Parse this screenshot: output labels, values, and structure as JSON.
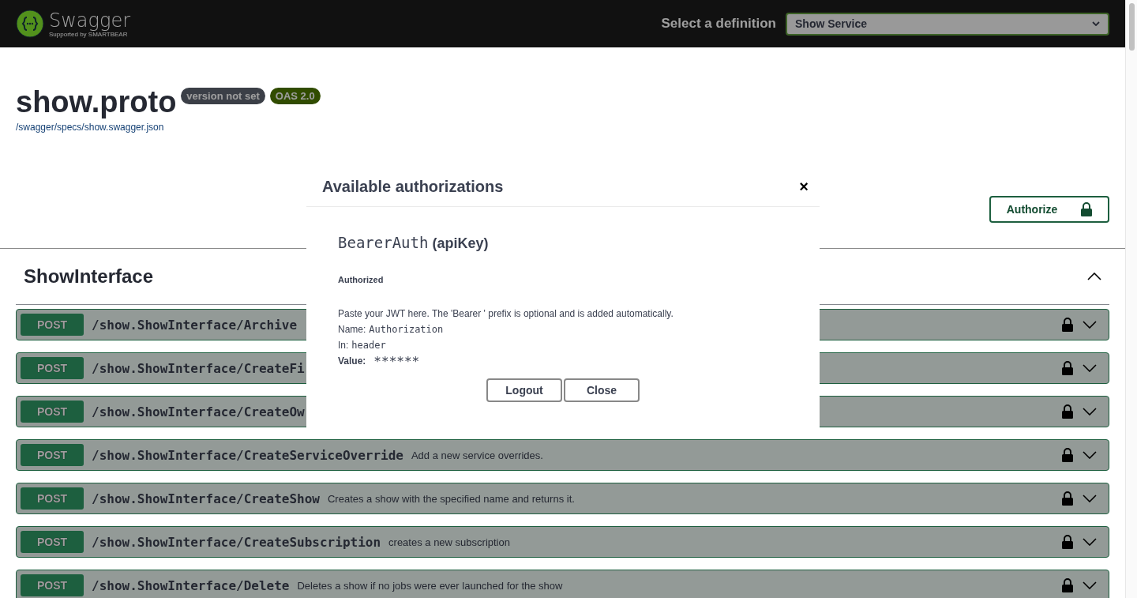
{
  "header": {
    "logo_text": "Swagger",
    "logo_subtext": "Supported by SMARTBEAR",
    "definition_label": "Select a definition",
    "definition_value": "Show Service"
  },
  "info": {
    "title": "show.proto",
    "version_badge": "version not set",
    "spec_badge": "OAS 2.0",
    "spec_link": "/swagger/specs/show.swagger.json"
  },
  "authorize_button": "Authorize",
  "section": {
    "title": "ShowInterface",
    "expanded": true
  },
  "operations": [
    {
      "method": "POST",
      "path": "/show.ShowInterface/Archive"
    },
    {
      "method": "POST",
      "path": "/show.ShowInterface/CreateFi"
    },
    {
      "method": "POST",
      "path": "/show.ShowInterface/CreateOw"
    },
    {
      "method": "POST",
      "path": "/show.ShowInterface/CreateServiceOverride",
      "summary": "Add a new service overrides."
    },
    {
      "method": "POST",
      "path": "/show.ShowInterface/CreateShow",
      "summary": "Creates a show with the specified name and returns it."
    },
    {
      "method": "POST",
      "path": "/show.ShowInterface/CreateSubscription",
      "summary": "creates a new subscription"
    },
    {
      "method": "POST",
      "path": "/show.ShowInterface/Delete",
      "summary": "Deletes a show if no jobs were ever launched for the show"
    }
  ],
  "modal": {
    "title": "Available authorizations",
    "close": "×",
    "scheme_name": "BearerAuth",
    "scheme_type": "(apiKey)",
    "status": "Authorized",
    "description": "Paste your JWT here. The 'Bearer ' prefix is optional and is added automatically.",
    "name_label": "Name:",
    "name_value": "Authorization",
    "in_label": "In:",
    "in_value": "header",
    "value_label": "Value:",
    "value": "******",
    "buttons": [
      "Logout",
      "Close"
    ]
  }
}
